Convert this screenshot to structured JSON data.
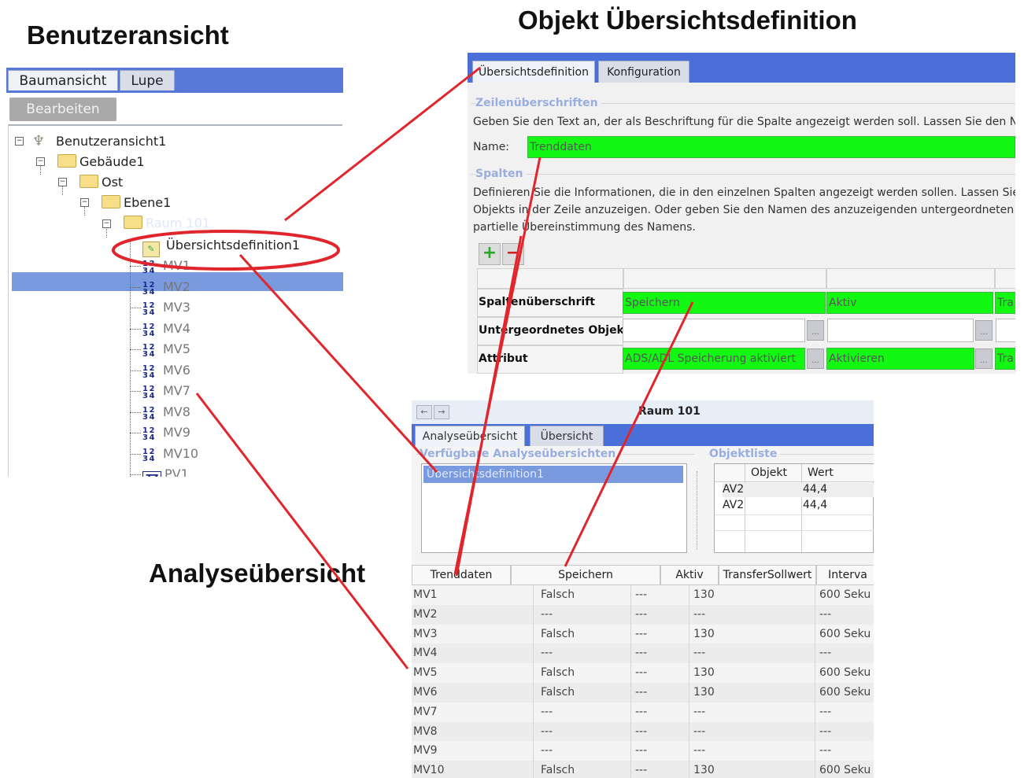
{
  "headings": {
    "user_view": "Benutzeransicht",
    "object_definition": "Objekt Übersichtsdefinition",
    "analysis": "Analyseübersicht"
  },
  "left_panel": {
    "tabs": [
      "Baumansicht",
      "Lupe"
    ],
    "edit_button": "Bearbeiten",
    "tree": {
      "root": "Benutzeransicht1",
      "building": "Gebäude1",
      "wing": "Ost",
      "level": "Ebene1",
      "room": "Raum 101",
      "definition": "Übersichtsdefinition1",
      "items": [
        "MV1",
        "MV2",
        "MV3",
        "MV4",
        "MV5",
        "MV6",
        "MV7",
        "MV8",
        "MV9",
        "MV10",
        "PV1"
      ]
    }
  },
  "definition_panel": {
    "tabs": [
      "Übersichtsdefinition",
      "Konfiguration"
    ],
    "row_headings_legend": "Zeilenüberschriften",
    "row_headings_text": "Geben Sie den Text an, der als Beschriftung für die Spalte angezeigt werden soll.  Lassen Sie den N",
    "name_label": "Name:",
    "name_value": "Trenddaten",
    "columns_legend": "Spalten",
    "columns_text": [
      "Definieren Sie die Informationen, die in den einzelnen Spalten angezeigt werden sollen.  Lassen Sie",
      "Objekts in der Zeile anzuzeigen.  Oder geben Sie den Namen des anzuzeigenden untergeordneten C",
      "partielle Übereinstimmung des Namens."
    ],
    "add_symbol": "+",
    "remove_symbol": "−",
    "grid_rows": [
      "Spaltenüberschrift",
      "Untergeordnetes Objekt",
      "Attribut"
    ],
    "col1": {
      "heading": "Speichern",
      "attribute": "ADS/ADL Speicherung aktiviert"
    },
    "col2": {
      "heading": "Aktiv",
      "attribute": "Aktivieren"
    },
    "col3": {
      "heading": "Tra",
      "attribute": "Tra"
    },
    "ellipsis": "..."
  },
  "analysis_panel": {
    "title": "Raum 101",
    "nav_back": "←",
    "nav_forward": "→",
    "tabs": [
      "Analyseübersicht",
      "Übersicht"
    ],
    "available_legend": "Verfügbare Analyseübersichten",
    "available_selected": "Übersichtsdefinition1",
    "objects_legend": "Objektliste",
    "objects_headers": [
      "Objekt",
      "Wert"
    ],
    "objects_rows": [
      [
        "AV2",
        "44,4"
      ],
      [
        "AV2",
        "44,4"
      ]
    ],
    "table_headers": [
      "Trenddaten",
      "Speichern",
      "Aktiv",
      "TransferSollwert",
      "Interva"
    ],
    "table_rows": [
      [
        "MV1",
        "Falsch",
        "---",
        "130",
        "600 Seku"
      ],
      [
        "MV2",
        "---",
        "---",
        "---",
        "---"
      ],
      [
        "MV3",
        "Falsch",
        "---",
        "130",
        "600 Seku"
      ],
      [
        "MV4",
        "---",
        "---",
        "---",
        "---"
      ],
      [
        "MV5",
        "Falsch",
        "---",
        "130",
        "600 Seku"
      ],
      [
        "MV6",
        "Falsch",
        "---",
        "130",
        "600 Seku"
      ],
      [
        "MV7",
        "---",
        "---",
        "---",
        "---"
      ],
      [
        "MV8",
        "---",
        "---",
        "---",
        "---"
      ],
      [
        "MV9",
        "---",
        "---",
        "---",
        "---"
      ],
      [
        "MV10",
        "Falsch",
        "---",
        "130",
        "600 Seku"
      ]
    ]
  },
  "colors": {
    "tab_blue": "#4b6fd8",
    "selection_blue": "#7a9ae0",
    "field_green": "#12f812",
    "annotation_red": "#e0262c",
    "legend_blue": "#98aee0"
  }
}
